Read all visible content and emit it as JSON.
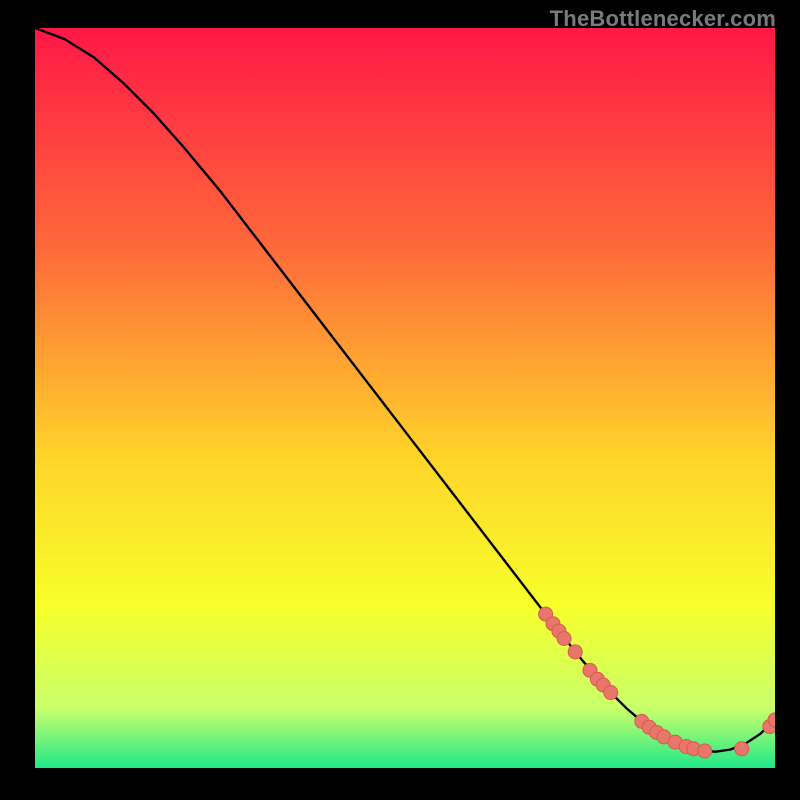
{
  "watermark": "TheBottlenecker.com",
  "colors": {
    "gradient_top": "#ff1846",
    "gradient_mid1": "#ff6a3a",
    "gradient_mid2": "#ffd42a",
    "gradient_mid3": "#f7ff2a",
    "gradient_mid4": "#c8ff6a",
    "gradient_bottom": "#20e88a",
    "curve": "#000000",
    "marker_fill": "#e8766a",
    "marker_stroke": "#d85a4e",
    "bg": "#000000"
  },
  "chart_data": {
    "type": "line",
    "title": "",
    "xlabel": "",
    "ylabel": "",
    "xlim": [
      0,
      100
    ],
    "ylim": [
      0,
      100
    ],
    "grid": false,
    "legend": false,
    "series": [
      {
        "name": "bottleneck-curve",
        "x": [
          0,
          4,
          8,
          12,
          16,
          20,
          25,
          30,
          35,
          40,
          45,
          50,
          55,
          60,
          65,
          70,
          74,
          78,
          80,
          82,
          84,
          86,
          88,
          90,
          92,
          94,
          96,
          98,
          100
        ],
        "y": [
          100.0,
          98.5,
          96.0,
          92.5,
          88.5,
          84.0,
          78.0,
          71.5,
          65.0,
          58.5,
          52.0,
          45.5,
          39.0,
          32.5,
          26.0,
          19.5,
          14.5,
          10.0,
          8.0,
          6.3,
          4.8,
          3.6,
          2.8,
          2.3,
          2.2,
          2.5,
          3.3,
          4.6,
          6.5
        ]
      }
    ],
    "markers": {
      "name": "highlighted-points",
      "x": [
        69.0,
        70.0,
        70.8,
        71.5,
        73.0,
        75.0,
        76.0,
        76.8,
        77.8,
        82.0,
        83.0,
        84.0,
        85.0,
        86.5,
        88.0,
        89.0,
        90.5,
        95.5,
        99.3,
        100.0
      ],
      "y": [
        20.8,
        19.5,
        18.5,
        17.5,
        15.7,
        13.2,
        12.0,
        11.2,
        10.2,
        6.3,
        5.5,
        4.8,
        4.2,
        3.5,
        2.9,
        2.6,
        2.3,
        2.6,
        5.6,
        6.5
      ]
    }
  }
}
